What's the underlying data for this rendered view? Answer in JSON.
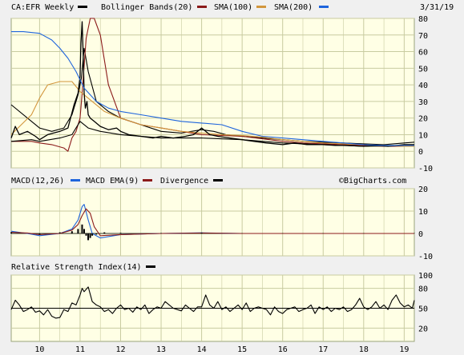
{
  "header": {
    "symbol": "CA:EFR Weekly",
    "date": "3/31/19"
  },
  "watermark": "©BigCharts.com",
  "colors": {
    "panel_bg": "#FFFFE5",
    "grid": "#C8CBA0",
    "frame": "#9aa37c",
    "outer_bg": "#F0F0F0",
    "price": "#000000",
    "sma100": "#8B1A1A",
    "sma200": "#D2963C",
    "bollinger": "#000000",
    "macd": "#1E64DC"
  },
  "chart_data": [
    {
      "type": "line",
      "title": "CA:EFR Weekly",
      "legend_position": "top",
      "x_ticks": [
        "10",
        "11",
        "12",
        "13",
        "14",
        "15",
        "16",
        "17",
        "18",
        "19"
      ],
      "y_ticks": [
        -10,
        0,
        10,
        20,
        30,
        40,
        50,
        60,
        70,
        80
      ],
      "ylim": [
        -10,
        80
      ],
      "grid": true,
      "series": [
        {
          "name": "Bollinger Bands(20)",
          "color": "#000000",
          "x": [
            2009.3,
            2009.8,
            2010.0,
            2010.3,
            2010.6,
            2010.8,
            2010.95,
            2011.03,
            2011.1,
            2011.2,
            2011.4,
            2011.7,
            2012.0,
            2012.5,
            2013.0,
            2013.5,
            2014.0,
            2014.3,
            2014.6,
            2015.0,
            2015.5,
            2016.0,
            2016.5,
            2017.0,
            2017.5,
            2018.0,
            2018.5,
            2019.0,
            2019.25
          ],
          "values": [
            28,
            18,
            14,
            12,
            14,
            22,
            34,
            44,
            62,
            48,
            30,
            24,
            20,
            16,
            12,
            11,
            13,
            12,
            10,
            9,
            8,
            7,
            6,
            5.5,
            5,
            4.5,
            4,
            5,
            5.5
          ]
        },
        {
          "name": "SMA(100)",
          "color": "#8B1A1A",
          "x": [
            2009.3,
            2009.8,
            2010.0,
            2010.3,
            2010.6,
            2010.7,
            2010.8,
            2010.9,
            2011.0,
            2011.05,
            2011.15,
            2011.25,
            2011.35,
            2011.5,
            2011.7,
            2012.0,
            2012.5,
            2013.0,
            2013.5,
            2014.0,
            2014.5,
            2015.0,
            2015.5,
            2016.0,
            2016.5,
            2017.0,
            2017.5,
            2018.0,
            2018.5,
            2019.0,
            2019.25
          ],
          "values": [
            6,
            6,
            5,
            4,
            2,
            0,
            8,
            12,
            20,
            35,
            68,
            80,
            80,
            70,
            40,
            20,
            16,
            14,
            12,
            10,
            9.5,
            9,
            7.5,
            6,
            5,
            4.5,
            4,
            3.5,
            3,
            3,
            3
          ]
        },
        {
          "name": "SMA(200)",
          "color": "#D2963C",
          "x": [
            2009.3,
            2009.8,
            2010.0,
            2010.2,
            2010.5,
            2010.8,
            2011.0,
            2011.3,
            2011.6,
            2012.0,
            2012.5,
            2013.0,
            2013.5,
            2014.0,
            2014.5,
            2015.0,
            2015.5,
            2016.0,
            2016.5,
            2017.0,
            2017.5,
            2018.0,
            2018.5,
            2019.0,
            2019.25
          ],
          "values": [
            10,
            22,
            32,
            40,
            42,
            42,
            36,
            30,
            24,
            20,
            16,
            14,
            12,
            11,
            10,
            9.5,
            8.5,
            7,
            6,
            5,
            4.5,
            4,
            3.5,
            3,
            3
          ]
        },
        {
          "name": "price",
          "color": "#000000",
          "x": [
            2009.3,
            2009.4,
            2009.5,
            2009.7,
            2009.9,
            2010.0,
            2010.2,
            2010.5,
            2010.7,
            2010.85,
            2010.95,
            2011.0,
            2011.02,
            2011.05,
            2011.08,
            2011.1,
            2011.13,
            2011.17,
            2011.2,
            2011.25,
            2011.35,
            2011.5,
            2011.7,
            2011.9,
            2012.0,
            2012.2,
            2012.5,
            2012.8,
            2013.0,
            2013.3,
            2013.6,
            2013.8,
            2014.0,
            2014.2,
            2014.4,
            2014.7,
            2015.0,
            2015.3,
            2015.6,
            2016.0,
            2016.3,
            2016.6,
            2017.0,
            2017.3,
            2017.6,
            2018.0,
            2018.3,
            2018.6,
            2019.0,
            2019.25
          ],
          "values": [
            8,
            15,
            10,
            12,
            9,
            7,
            10,
            12,
            14,
            28,
            35,
            45,
            65,
            78,
            55,
            35,
            26,
            30,
            22,
            20,
            18,
            15,
            13,
            14,
            12,
            10,
            9,
            8,
            9,
            8,
            9,
            10,
            14,
            10,
            9,
            8,
            7,
            6,
            5,
            4,
            5,
            4,
            4,
            3.5,
            3.5,
            3,
            3.5,
            3,
            4,
            4
          ]
        },
        {
          "name": "upper-lower-band",
          "color": "#000000",
          "x": [
            2009.3,
            2009.8,
            2010.0,
            2010.5,
            2010.8,
            2011.0,
            2011.2,
            2011.5,
            2012.0,
            2013.0,
            2014.0,
            2015.0,
            2016.0,
            2017.0,
            2018.0,
            2019.0,
            2019.25
          ],
          "values": [
            6,
            7,
            6,
            8,
            10,
            18,
            14,
            12,
            10,
            8,
            8,
            7,
            5,
            4,
            3,
            3.5,
            3.5
          ]
        },
        {
          "name": "long-ma",
          "color": "#1E64DC",
          "x": [
            2009.3,
            2009.6,
            2010.0,
            2010.3,
            2010.5,
            2010.7,
            2010.9,
            2011.1,
            2011.4,
            2011.7,
            2012.0,
            2012.5,
            2013.0,
            2013.5,
            2014.0,
            2014.5,
            2015.0,
            2015.5,
            2016.0,
            2016.5,
            2017.0,
            2017.5,
            2018.0,
            2018.5,
            2019.0,
            2019.25
          ],
          "values": [
            72,
            72,
            71,
            67,
            62,
            56,
            48,
            38,
            30,
            26,
            24,
            22,
            20,
            18,
            17,
            16,
            12,
            9,
            8,
            7,
            6,
            5,
            4,
            3.5,
            3.5,
            3.5
          ]
        }
      ]
    },
    {
      "type": "line",
      "title": "",
      "legend": [
        "MACD(12,26)",
        "MACD EMA(9)",
        "Divergence"
      ],
      "legend_position": "top",
      "x_ticks": [
        "10",
        "11",
        "12",
        "13",
        "14",
        "15",
        "16",
        "17",
        "18",
        "19"
      ],
      "y_ticks": [
        -10,
        0,
        10,
        20
      ],
      "ylim": [
        -10,
        20
      ],
      "grid": true,
      "series": [
        {
          "name": "MACD(12,26)",
          "color": "#1E64DC",
          "x": [
            2009.3,
            2009.7,
            2010.0,
            2010.5,
            2010.8,
            2010.95,
            2011.05,
            2011.1,
            2011.2,
            2011.3,
            2011.5,
            2012.0,
            2013.0,
            2014.0,
            2015.0,
            2016.0,
            2017.0,
            2018.0,
            2019.25
          ],
          "values": [
            1,
            0,
            -1,
            0,
            2,
            6,
            12,
            13,
            6,
            0,
            -2,
            -0.5,
            0,
            0.3,
            0,
            0,
            0,
            0,
            0
          ]
        },
        {
          "name": "MACD EMA(9)",
          "color": "#8B1A1A",
          "x": [
            2009.3,
            2009.7,
            2010.0,
            2010.5,
            2010.8,
            2010.95,
            2011.05,
            2011.15,
            2011.25,
            2011.35,
            2011.5,
            2012.0,
            2013.0,
            2014.0,
            2015.0,
            2016.0,
            2017.0,
            2018.0,
            2019.25
          ],
          "values": [
            0.5,
            0.2,
            -0.5,
            0,
            1.5,
            4,
            8,
            11,
            9,
            3,
            -1,
            -0.5,
            0,
            0.2,
            0,
            0,
            0,
            0,
            0
          ]
        },
        {
          "name": "Divergence",
          "color": "#000000",
          "x": [
            2009.3,
            2010.0,
            2010.5,
            2010.8,
            2010.95,
            2011.05,
            2011.1,
            2011.15,
            2011.2,
            2011.25,
            2011.3,
            2011.4,
            2011.6,
            2012.0,
            2013.0,
            2014.0,
            2015.0,
            2016.0,
            2017.0,
            2018.0,
            2019.25
          ],
          "values": [
            0.5,
            -0.5,
            0.5,
            1,
            2,
            4,
            2,
            -1,
            -3,
            -2,
            -1,
            -0.5,
            0.5,
            0.3,
            0.2,
            0.3,
            0.1,
            0.1,
            0.1,
            0.1,
            0.1
          ]
        }
      ]
    },
    {
      "type": "line",
      "title": "Relative Strength Index(14)",
      "legend_position": "top",
      "x_ticks": [
        "10",
        "11",
        "12",
        "13",
        "14",
        "15",
        "16",
        "17",
        "18",
        "19"
      ],
      "y_ticks": [
        20,
        50,
        80,
        100
      ],
      "ylim": [
        0,
        100
      ],
      "grid": true,
      "reference_line": 50,
      "series": [
        {
          "name": "RSI(14)",
          "color": "#000000",
          "x": [
            2009.3,
            2009.4,
            2009.5,
            2009.6,
            2009.7,
            2009.8,
            2009.9,
            2010.0,
            2010.1,
            2010.2,
            2010.3,
            2010.4,
            2010.5,
            2010.6,
            2010.7,
            2010.8,
            2010.9,
            2011.0,
            2011.05,
            2011.1,
            2011.2,
            2011.3,
            2011.4,
            2011.5,
            2011.6,
            2011.7,
            2011.8,
            2011.9,
            2012.0,
            2012.1,
            2012.2,
            2012.3,
            2012.4,
            2012.5,
            2012.6,
            2012.7,
            2012.8,
            2012.9,
            2013.0,
            2013.1,
            2013.2,
            2013.3,
            2013.4,
            2013.5,
            2013.6,
            2013.7,
            2013.8,
            2013.9,
            2014.0,
            2014.1,
            2014.2,
            2014.3,
            2014.4,
            2014.5,
            2014.6,
            2014.7,
            2014.8,
            2014.9,
            2015.0,
            2015.1,
            2015.2,
            2015.3,
            2015.4,
            2015.5,
            2015.6,
            2015.7,
            2015.8,
            2015.9,
            2016.0,
            2016.1,
            2016.2,
            2016.3,
            2016.4,
            2016.5,
            2016.6,
            2016.7,
            2016.8,
            2016.9,
            2017.0,
            2017.1,
            2017.2,
            2017.3,
            2017.4,
            2017.5,
            2017.6,
            2017.7,
            2017.8,
            2017.9,
            2018.0,
            2018.1,
            2018.2,
            2018.3,
            2018.4,
            2018.5,
            2018.6,
            2018.7,
            2018.8,
            2018.9,
            2019.0,
            2019.1,
            2019.2,
            2019.25
          ],
          "values": [
            48,
            62,
            55,
            45,
            48,
            52,
            44,
            46,
            40,
            48,
            38,
            35,
            36,
            48,
            45,
            58,
            55,
            70,
            80,
            75,
            82,
            60,
            55,
            52,
            45,
            48,
            42,
            50,
            55,
            48,
            50,
            44,
            52,
            48,
            55,
            42,
            48,
            52,
            50,
            60,
            55,
            50,
            48,
            46,
            55,
            50,
            45,
            52,
            52,
            70,
            55,
            50,
            60,
            48,
            52,
            45,
            50,
            55,
            48,
            58,
            45,
            50,
            52,
            50,
            48,
            40,
            52,
            45,
            42,
            48,
            50,
            52,
            45,
            48,
            50,
            55,
            42,
            52,
            48,
            52,
            45,
            50,
            48,
            52,
            45,
            48,
            55,
            65,
            52,
            48,
            52,
            60,
            50,
            55,
            48,
            62,
            70,
            58,
            52,
            55,
            50,
            62
          ]
        }
      ]
    }
  ]
}
